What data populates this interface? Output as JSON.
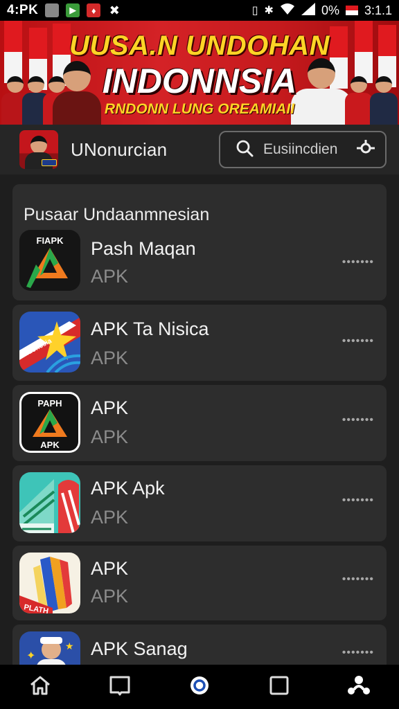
{
  "status_bar": {
    "time": "4:PK",
    "battery_percent": "0%",
    "clock": "3:1.1"
  },
  "banner": {
    "line1": "UUSA.N UNDOHAN",
    "line2": "INDONNSIA",
    "line3": "RNDONN LUNG OREAMIAII"
  },
  "header": {
    "title": "UNonurcian",
    "search_placeholder": "Eusiincdien"
  },
  "section": {
    "title": "Pusaar Undaanmnesian"
  },
  "apps": [
    {
      "name": "Pash Maqan",
      "sub": "APK",
      "icon_text": "FIAPK"
    },
    {
      "name": "APK Ta Nisica",
      "sub": "APK",
      "icon_text": "Indonesia"
    },
    {
      "name": "APK",
      "sub": "APK",
      "icon_text_top": "PAPH",
      "icon_text_bottom": "APK"
    },
    {
      "name": "APK Apk",
      "sub": "APK",
      "icon_text": ""
    },
    {
      "name": "APK",
      "sub": "APK",
      "icon_text": "PLATH"
    },
    {
      "name": "APK Sanag",
      "sub": "",
      "icon_text": ""
    }
  ],
  "more_label": "•••••••",
  "colors": {
    "banner_red": "#c51a1d",
    "banner_yellow": "#ffd426",
    "card_bg": "#2d2d2d",
    "app_bg": "#1e1e1e"
  },
  "icons": [
    "home-icon",
    "bookmark-icon",
    "circle-icon",
    "square-icon",
    "people-icon"
  ]
}
